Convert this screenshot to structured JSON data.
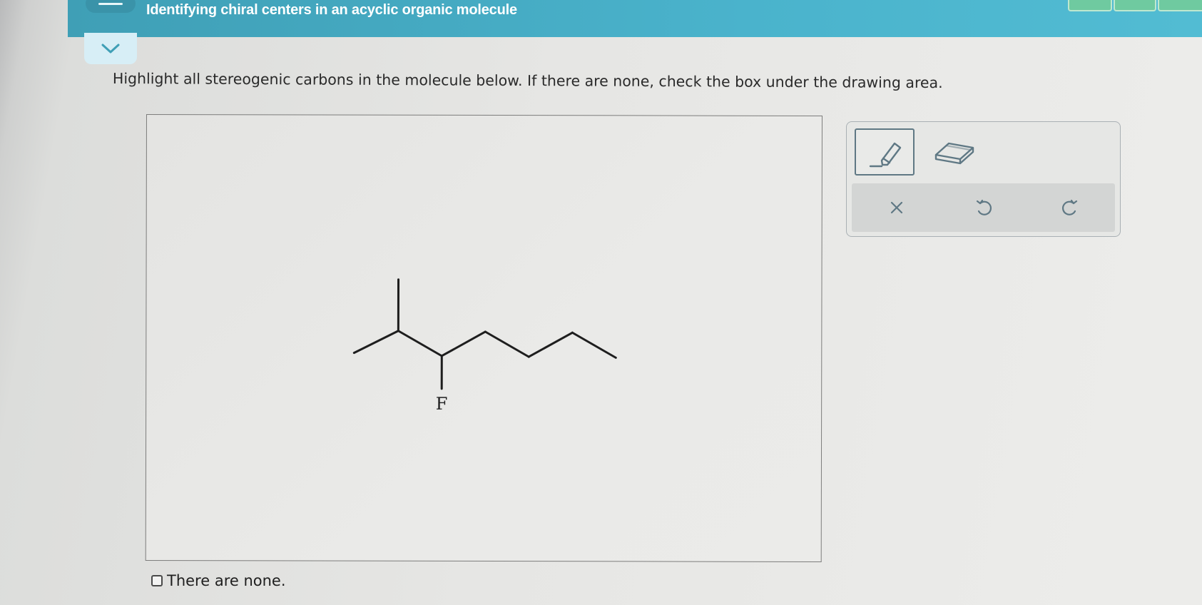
{
  "header": {
    "title": "Identifying chiral centers in an acyclic organic molecule"
  },
  "question": {
    "prompt": "Highlight all stereogenic carbons in the molecule below. If there are none, check the box under the drawing area."
  },
  "molecule": {
    "atom_label": "F"
  },
  "none_option": {
    "label": "There are none.",
    "checked": false
  },
  "toolbox": {
    "tools": [
      "highlighter-icon",
      "eraser-icon"
    ],
    "actions": [
      "clear-icon",
      "undo-icon",
      "redo-icon"
    ],
    "clear_glyph": "×"
  },
  "colors": {
    "header": "#4ab3cc",
    "text": "#2a2a2a",
    "tool_border": "#5f7884"
  }
}
